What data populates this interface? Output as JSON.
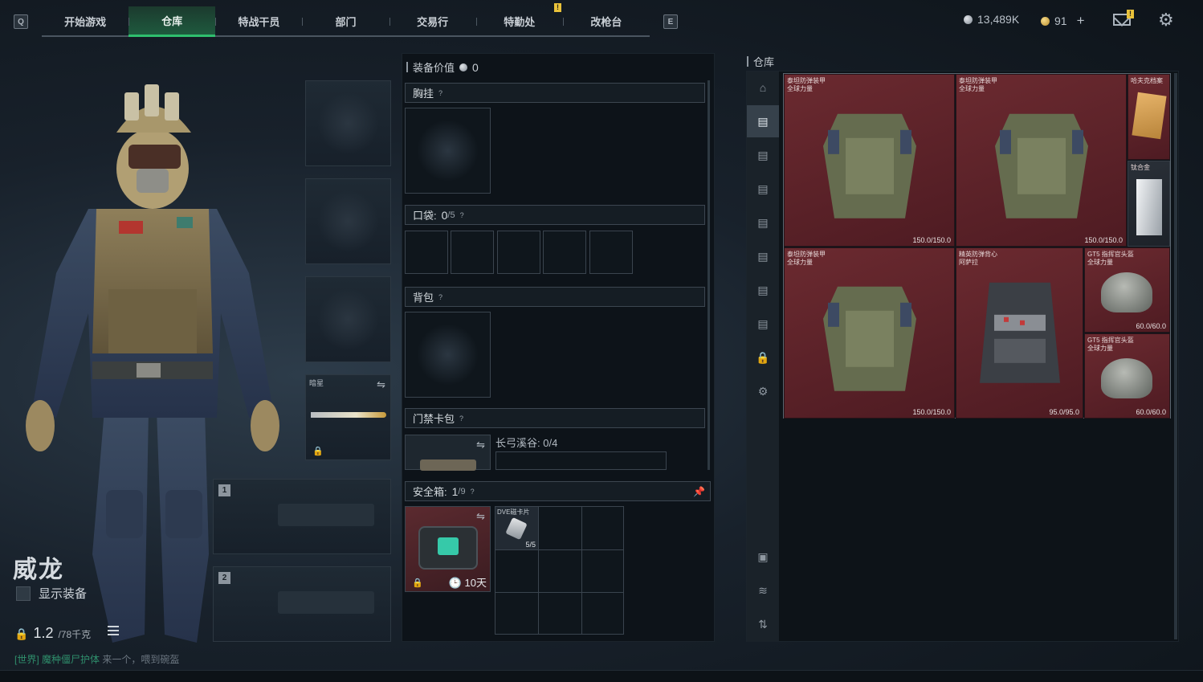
{
  "topbar": {
    "key_left": "Q",
    "key_right": "E",
    "tabs": [
      "开始游戏",
      "仓库",
      "特战干员",
      "部门",
      "交易行",
      "特勤处",
      "改枪台"
    ],
    "active_tab": "仓库",
    "tab_badge": "!",
    "silver": "13,489K",
    "gold": "91",
    "add": "+",
    "mail_badge": "!"
  },
  "operator": {
    "name": "威龙",
    "show_gear_label": "显示装备",
    "weight_value": "1.2",
    "weight_limit": "/78千克",
    "chat_channel": "[世界]",
    "chat_user": "魔种僵尸护体",
    "chat_text": "来一个，喂到碗盔"
  },
  "slots": {
    "melee_label": "暗星",
    "primary_num": "1",
    "secondary_num": "2"
  },
  "loadout": {
    "value_label": "装备价值",
    "value": "0",
    "rig_label": "胸挂",
    "pockets_label": "口袋:",
    "pockets_used": "0",
    "pockets_total": "/5",
    "backpack_label": "背包",
    "keycard_label": "门禁卡包",
    "keycard_map": "长弓溪谷: 0/4",
    "safebox_label": "安全箱:",
    "safebox_used": "1",
    "safebox_total": "/9",
    "safebox_days": "10天",
    "safebox_item_name": "DVE磁卡片",
    "safebox_item_count": "5/5"
  },
  "warehouse": {
    "title": "仓库",
    "items": [
      {
        "name": "泰坦防弹装甲\n全球力量",
        "durability": "150.0/150.0"
      },
      {
        "name": "泰坦防弹装甲\n全球力量",
        "durability": "150.0/150.0"
      },
      {
        "name": "哈夫克档案",
        "durability": ""
      },
      {
        "name": "钛合金",
        "durability": ""
      },
      {
        "name": "泰坦防弹装甲\n全球力量",
        "durability": "150.0/150.0"
      },
      {
        "name": "精英防弹背心\n阿萨拉",
        "durability": "95.0/95.0"
      },
      {
        "name": "GT5 指挥官头盔\n全球力量",
        "durability": "60.0/60.0"
      },
      {
        "name": "GT5 指挥官头盔\n全球力量",
        "durability": "60.0/60.0"
      }
    ]
  },
  "colors": {
    "accent_green": "#2fbf6e",
    "badge_yellow": "#e9c23a",
    "item_red": "#6b2a30"
  }
}
